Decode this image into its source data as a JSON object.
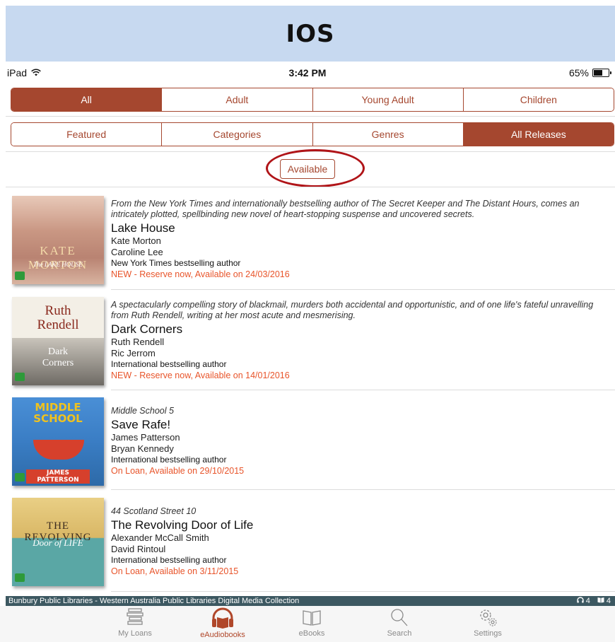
{
  "banner": {
    "title": "IOS"
  },
  "status_bar": {
    "device": "iPad",
    "time": "3:42 PM",
    "battery": "65%",
    "battery_level": 0.65
  },
  "filter_audience": {
    "options": [
      "All",
      "Adult",
      "Young Adult",
      "Children"
    ],
    "selected": "All"
  },
  "filter_view": {
    "options": [
      "Featured",
      "Categories",
      "Genres",
      "All Releases"
    ],
    "selected": "All Releases"
  },
  "available_button": "Available",
  "books": [
    {
      "blurb": "From the New York Times and internationally bestselling author of The Secret Keeper and The Distant Hours, comes an intricately plotted, spellbinding new novel of heart-stopping suspense and uncovered secrets.",
      "title": "Lake House",
      "author": "Kate Morton",
      "narrator": "Caroline Lee",
      "tag": "New York Times bestselling author",
      "status": "NEW - Reserve now, Available on 24/03/2016",
      "cover_title": "KATE MORTON",
      "cover_subtitle": "The LAKE HOUSE"
    },
    {
      "blurb": "A spectacularly compelling story of blackmail, murders both accidental and opportunistic, and of one life's fateful unravelling from Ruth Rendell, writing at her most acute and mesmerising.",
      "title": "Dark Corners",
      "author": "Ruth Rendell",
      "narrator": "Ric Jerrom",
      "tag": "International bestselling author",
      "status": "NEW - Reserve now, Available on 14/01/2016",
      "cover_title": "Ruth Rendell",
      "cover_subtitle": "Dark Corners"
    },
    {
      "series": "Middle School 5",
      "title": "Save Rafe!",
      "author": "James Patterson",
      "narrator": "Bryan Kennedy",
      "tag": "International bestselling author",
      "status": "On Loan, Available on 29/10/2015",
      "cover_title": "MIDDLE SCHOOL",
      "cover_subtitle": "JAMES PATTERSON"
    },
    {
      "series": "44 Scotland Street 10",
      "title": "The Revolving Door of Life",
      "author": "Alexander McCall Smith",
      "narrator": "David Rintoul",
      "tag": "International bestselling author",
      "status": "On Loan, Available on 3/11/2015",
      "cover_title": "THE REVOLVING",
      "cover_subtitle": "Door of LIFE"
    }
  ],
  "footer": {
    "collection": "Bunbury Public Libraries - Western Australia Public Libraries Digital Media Collection",
    "audio_count": "4",
    "ebook_count": "4"
  },
  "tabs": [
    "My Loans",
    "eAudiobooks",
    "eBooks",
    "Search",
    "Settings"
  ],
  "active_tab": "eAudiobooks",
  "colors": {
    "accent": "#a5472f",
    "status": "#e8542a",
    "banner": "#c7d9f0",
    "footer": "#3c5861",
    "highlight_ring": "#b01418"
  }
}
